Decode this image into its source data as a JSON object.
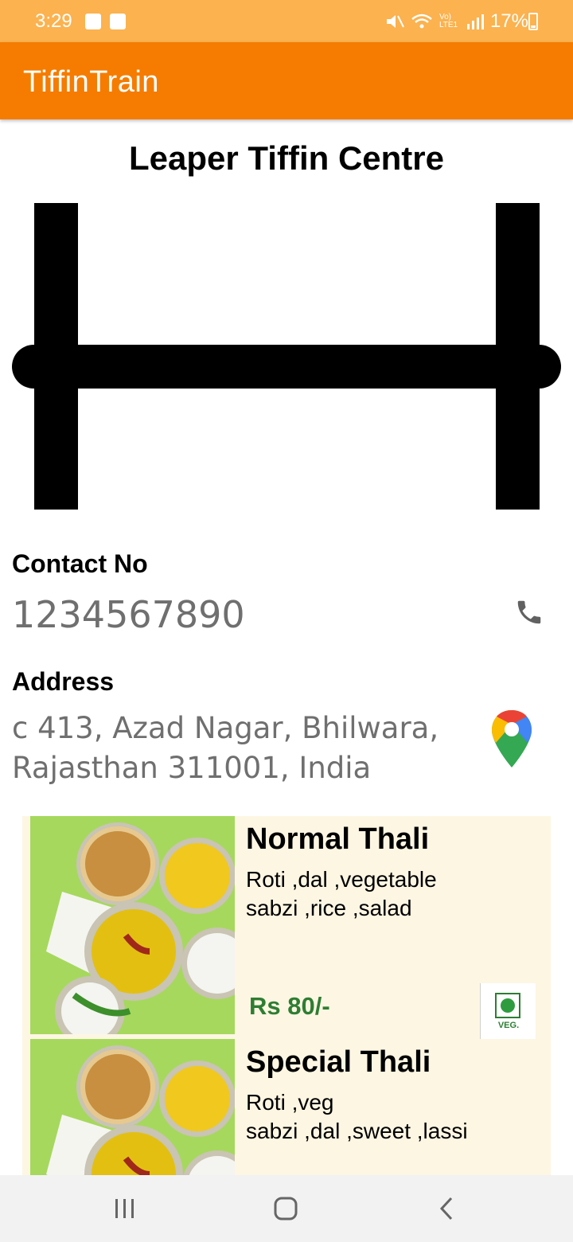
{
  "status_bar": {
    "time": "3:29",
    "network_text": "Vo) LTE1",
    "battery": "17%"
  },
  "app_bar": {
    "title": "TiffinTrain"
  },
  "shop": {
    "name": "Leaper Tiffin Centre",
    "contact_label": "Contact No",
    "contact_number": "1234567890",
    "address_label": "Address",
    "address_line1": "c 413, Azad Nagar, Bhilwara,",
    "address_line2": "Rajasthan 311001, India"
  },
  "menu": [
    {
      "name": "Normal Thali",
      "desc_line1": "Roti ,dal ,vegetable",
      "desc_line2": "sabzi ,rice ,salad",
      "price": "Rs 80/-",
      "veg_label": "VEG."
    },
    {
      "name": "Special Thali",
      "desc_line1": "Roti ,veg",
      "desc_line2": "sabzi ,dal ,sweet ,lassi"
    }
  ],
  "colors": {
    "status_bar": "#fbb24f",
    "app_bar": "#f57c00",
    "price": "#2e7d32",
    "card_bg": "#fdf6e3"
  }
}
